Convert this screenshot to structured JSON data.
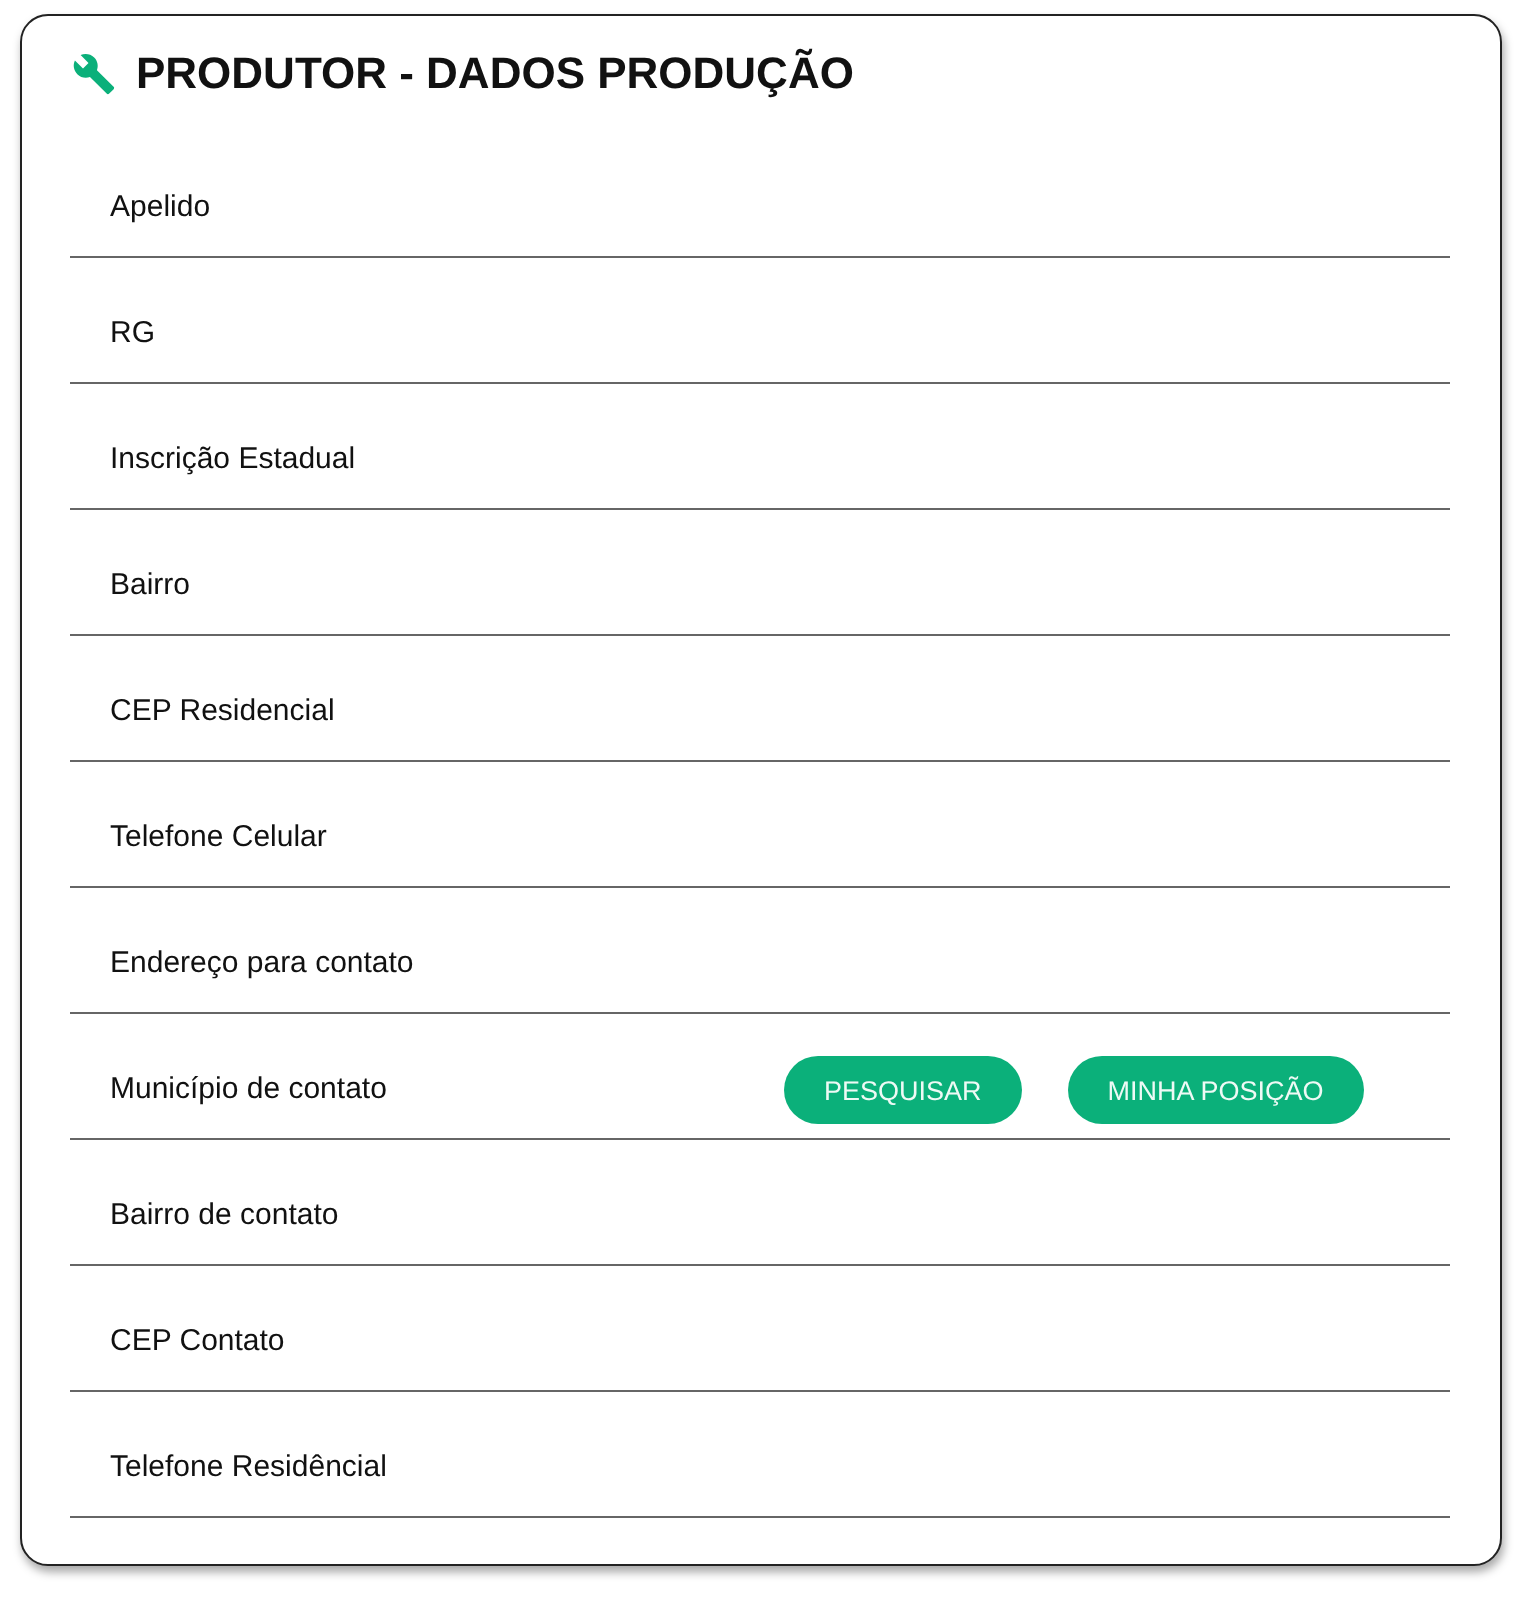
{
  "title": "PRODUTOR - DADOS PRODUÇÃO",
  "fields": [
    {
      "placeholder": "Apelido"
    },
    {
      "placeholder": "RG"
    },
    {
      "placeholder": "Inscrição Estadual"
    },
    {
      "placeholder": "Bairro"
    },
    {
      "placeholder": "CEP Residencial"
    },
    {
      "placeholder": "Telefone Celular"
    },
    {
      "placeholder": "Endereço para contato"
    },
    {
      "placeholder": "Município de contato",
      "buttons": [
        "PESQUISAR",
        "MINHA POSIÇÃO"
      ]
    },
    {
      "placeholder": "Bairro de contato"
    },
    {
      "placeholder": "CEP Contato"
    },
    {
      "placeholder": "Telefone Residêncial"
    }
  ]
}
